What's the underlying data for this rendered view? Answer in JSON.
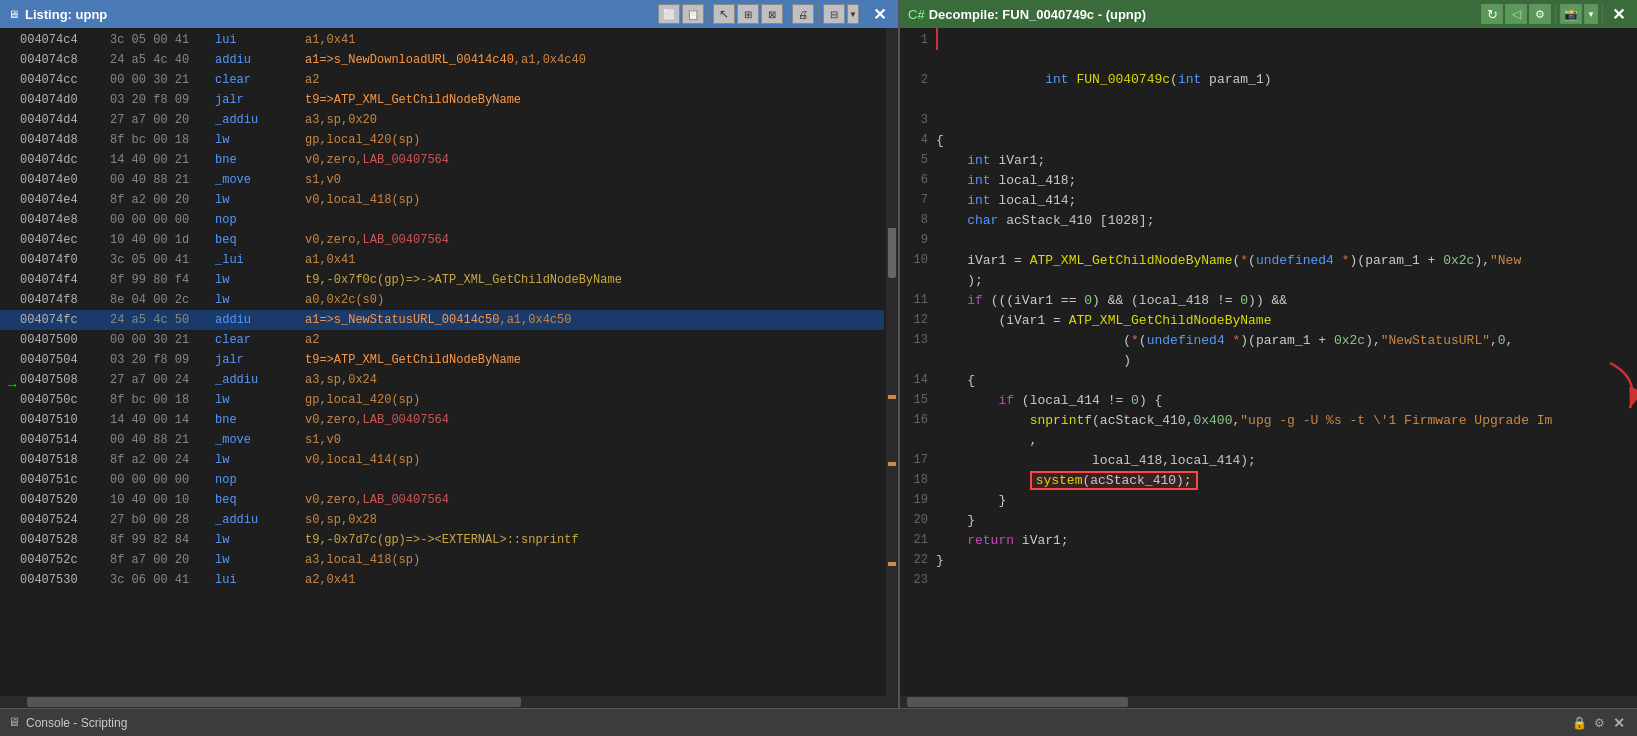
{
  "listing_title": "Listing:  upnp",
  "decompile_title": "Decompile: FUN_0040749c - (upnp)",
  "status_bar": {
    "text": "Console - Scripting"
  },
  "listing_lines": [
    {
      "addr": "004074c4",
      "bytes": "3c 05 00 41",
      "instr": "lui",
      "args": "a1,0x41"
    },
    {
      "addr": "004074c8",
      "bytes": "24 a5 4c 40",
      "instr": "addiu",
      "args": "a1=>s_NewDownloadURL_00414c40,a1,0x4c40",
      "arg_type": "func"
    },
    {
      "addr": "004074cc",
      "bytes": "00 00 30 21",
      "instr": "clear",
      "args": "a2"
    },
    {
      "addr": "004074d0",
      "bytes": "03 20 f8 09",
      "instr": "jalr",
      "args": "t9=>ATP_XML_GetChildNodeByName",
      "arg_type": "func"
    },
    {
      "addr": "004074d4",
      "bytes": "27 a7 00 20",
      "instr": "_addiu",
      "args": "a3,sp,0x20"
    },
    {
      "addr": "004074d8",
      "bytes": "8f bc 00 18",
      "instr": "lw",
      "args": "gp,local_420(sp)"
    },
    {
      "addr": "004074dc",
      "bytes": "14 40 00 21",
      "instr": "bne",
      "args": "v0,zero,LAB_00407564",
      "arg_type": "label"
    },
    {
      "addr": "004074e0",
      "bytes": "00 40 88 21",
      "instr": "_move",
      "args": "s1,v0"
    },
    {
      "addr": "004074e4",
      "bytes": "8f a2 00 20",
      "instr": "lw",
      "args": "v0,local_418(sp)"
    },
    {
      "addr": "004074e8",
      "bytes": "00 00 00 00",
      "instr": "nop",
      "args": ""
    },
    {
      "addr": "004074ec",
      "bytes": "10 40 00 1d",
      "instr": "beq",
      "args": "v0,zero,LAB_00407564",
      "arg_type": "label"
    },
    {
      "addr": "004074f0",
      "bytes": "3c 05 00 41",
      "instr": "_lui",
      "args": "a1,0x41"
    },
    {
      "addr": "004074f4",
      "bytes": "8f 99 80 f4",
      "instr": "lw",
      "args": "t9,-0x7f0c(gp)=>->ATP_XML_GetChildNodeByName",
      "arg_type": "arrow"
    },
    {
      "addr": "004074f8",
      "bytes": "8e 04 00 2c",
      "instr": "lw",
      "args": "a0,0x2c(s0)"
    },
    {
      "addr": "004074fc",
      "bytes": "24 a5 4c 50",
      "instr": "addiu",
      "args": "a1=>s_NewStatusURL_00414c50,a1,0x4c50",
      "arg_type": "func",
      "highlight": true
    },
    {
      "addr": "00407500",
      "bytes": "00 00 30 21",
      "instr": "clear",
      "args": "a2"
    },
    {
      "addr": "00407504",
      "bytes": "03 20 f8 09",
      "instr": "jalr",
      "args": "t9=>ATP_XML_GetChildNodeByName",
      "arg_type": "func"
    },
    {
      "addr": "00407508",
      "bytes": "27 a7 00 24",
      "instr": "_addiu",
      "args": "a3,sp,0x24"
    },
    {
      "addr": "0040750c",
      "bytes": "8f bc 00 18",
      "instr": "lw",
      "args": "gp,local_420(sp)"
    },
    {
      "addr": "00407510",
      "bytes": "14 40 00 14",
      "instr": "bne",
      "args": "v0,zero,LAB_00407564",
      "arg_type": "label"
    },
    {
      "addr": "00407514",
      "bytes": "00 40 88 21",
      "instr": "_move",
      "args": "s1,v0"
    },
    {
      "addr": "00407518",
      "bytes": "8f a2 00 24",
      "instr": "lw",
      "args": "v0,local_414(sp)"
    },
    {
      "addr": "0040751c",
      "bytes": "00 00 00 00",
      "instr": "nop",
      "args": ""
    },
    {
      "addr": "00407520",
      "bytes": "10 40 00 10",
      "instr": "beq",
      "args": "v0,zero,LAB_00407564",
      "arg_type": "label"
    },
    {
      "addr": "00407524",
      "bytes": "27 b0 00 28",
      "instr": "_addiu",
      "args": "s0,sp,0x28"
    },
    {
      "addr": "00407528",
      "bytes": "8f 99 82 84",
      "instr": "lw",
      "args": "t9,-0x7d7c(gp)=>-><EXTERNAL>::snprintf",
      "arg_type": "arrow"
    },
    {
      "addr": "0040752c",
      "bytes": "8f a7 00 20",
      "instr": "lw",
      "args": "a3,local_418(sp)"
    },
    {
      "addr": "00407530",
      "bytes": "3c 06 00 41",
      "instr": "lui",
      "args": "a2,0x41"
    }
  ],
  "decompile_lines": [
    {
      "num": 1,
      "content": ""
    },
    {
      "num": 2,
      "content": "int FUN_0040749c(int param_1)",
      "type": "signature"
    },
    {
      "num": 3,
      "content": ""
    },
    {
      "num": 4,
      "content": "{"
    },
    {
      "num": 5,
      "content": "    int iVar1;",
      "type": "decl"
    },
    {
      "num": 6,
      "content": "    int local_418;",
      "type": "decl"
    },
    {
      "num": 7,
      "content": "    int local_414;",
      "type": "decl"
    },
    {
      "num": 8,
      "content": "    char acStack_410 [1028];",
      "type": "decl"
    },
    {
      "num": 9,
      "content": ""
    },
    {
      "num": 10,
      "content": "    iVar1 = ATP_XML_GetChildNodeByName(*(undefined4 *)(param_1 + 0x2c),\"New",
      "type": "code"
    },
    {
      "num": 10.1,
      "content": "    );",
      "type": "code"
    },
    {
      "num": 11,
      "content": "    if (((iVar1 == 0) && (local_418 != 0)) &&",
      "type": "code"
    },
    {
      "num": 12,
      "content": "        (iVar1 = ATP_XML_GetChildNodeByName",
      "type": "code"
    },
    {
      "num": 13,
      "content": "                        (*(undefined4 *)(param_1 + 0x2c),\"NewStatusURL\",0,",
      "type": "code"
    },
    {
      "num": 13.1,
      "content": "                        )",
      "type": "code"
    },
    {
      "num": 14,
      "content": "    {",
      "type": "code"
    },
    {
      "num": 15,
      "content": "        if (local_414 != 0) {",
      "type": "code"
    },
    {
      "num": 16,
      "content": "            snprintf(acStack_410,0x400,\"upg -g -U %s -t \\'1 Firmware Upgrade Im",
      "type": "code",
      "has_arrow": true
    },
    {
      "num": 16.1,
      "content": "            ,",
      "type": "code"
    },
    {
      "num": 17,
      "content": "                    local_418,local_414);",
      "type": "code"
    },
    {
      "num": 18,
      "content": "            system(acStack_410);",
      "type": "code",
      "highlight": true
    },
    {
      "num": 19,
      "content": "        }",
      "type": "code"
    },
    {
      "num": 20,
      "content": "    }",
      "type": "code"
    },
    {
      "num": 21,
      "content": "    return iVar1;",
      "type": "code"
    },
    {
      "num": 22,
      "content": "}",
      "type": "code"
    },
    {
      "num": 23,
      "content": ""
    }
  ]
}
